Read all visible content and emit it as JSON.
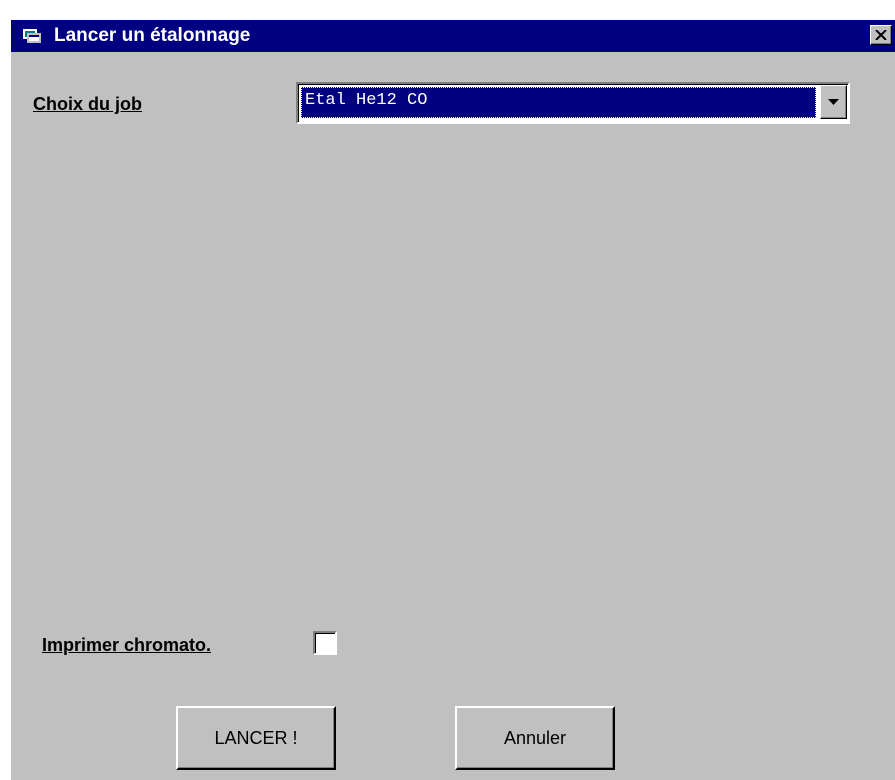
{
  "window": {
    "title": "Lancer un étalonnage",
    "title_bar_color": "#000080",
    "background_color": "#c0c0c0"
  },
  "job": {
    "label": "Choix du job",
    "selected_value": "Etal He12 CO",
    "dropdown_icon": "chevron-down-icon"
  },
  "print": {
    "label": "Imprimer chromato.",
    "checked": false
  },
  "buttons": {
    "launch_label": "LANCER !",
    "cancel_label": "Annuler"
  }
}
